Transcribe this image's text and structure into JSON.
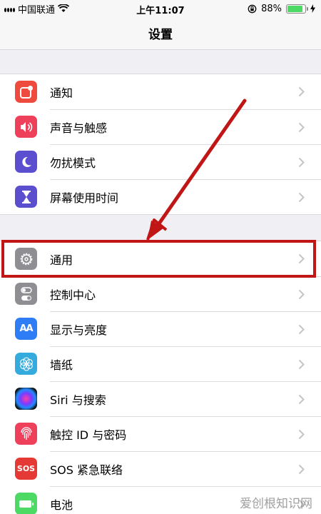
{
  "status_bar": {
    "carrier": "中国联通",
    "time": "上午11:07",
    "battery": "88%"
  },
  "nav": {
    "title": "设置"
  },
  "group1": [
    {
      "label": "通知",
      "icon": "notification-icon",
      "color": "#ef4a3e"
    },
    {
      "label": "声音与触感",
      "icon": "sound-icon",
      "color": "#ee3f5b"
    },
    {
      "label": "勿扰模式",
      "icon": "moon-icon",
      "color": "#5b4fd0"
    },
    {
      "label": "屏幕使用时间",
      "icon": "hourglass-icon",
      "color": "#5b4fd0"
    }
  ],
  "group2": [
    {
      "label": "通用",
      "icon": "gear-icon",
      "color": "#8e8e93"
    },
    {
      "label": "控制中心",
      "icon": "toggles-icon",
      "color": "#8e8e93"
    },
    {
      "label": "显示与亮度",
      "icon": "display-icon",
      "color": "#2f7df6",
      "glyph": "AA"
    },
    {
      "label": "墙纸",
      "icon": "flower-icon",
      "color": "#35aadc"
    },
    {
      "label": "Siri 与搜索",
      "icon": "siri-icon",
      "color": "#1a1a2e"
    },
    {
      "label": "触控 ID 与密码",
      "icon": "fingerprint-icon",
      "color": "#ee3f5b"
    },
    {
      "label": "SOS 紧急联络",
      "icon": "sos-icon",
      "color": "#e53935",
      "glyph": "SOS"
    },
    {
      "label": "电池",
      "icon": "battery-icon",
      "color": "#4cd964"
    }
  ],
  "watermark": "爱创根知识网"
}
